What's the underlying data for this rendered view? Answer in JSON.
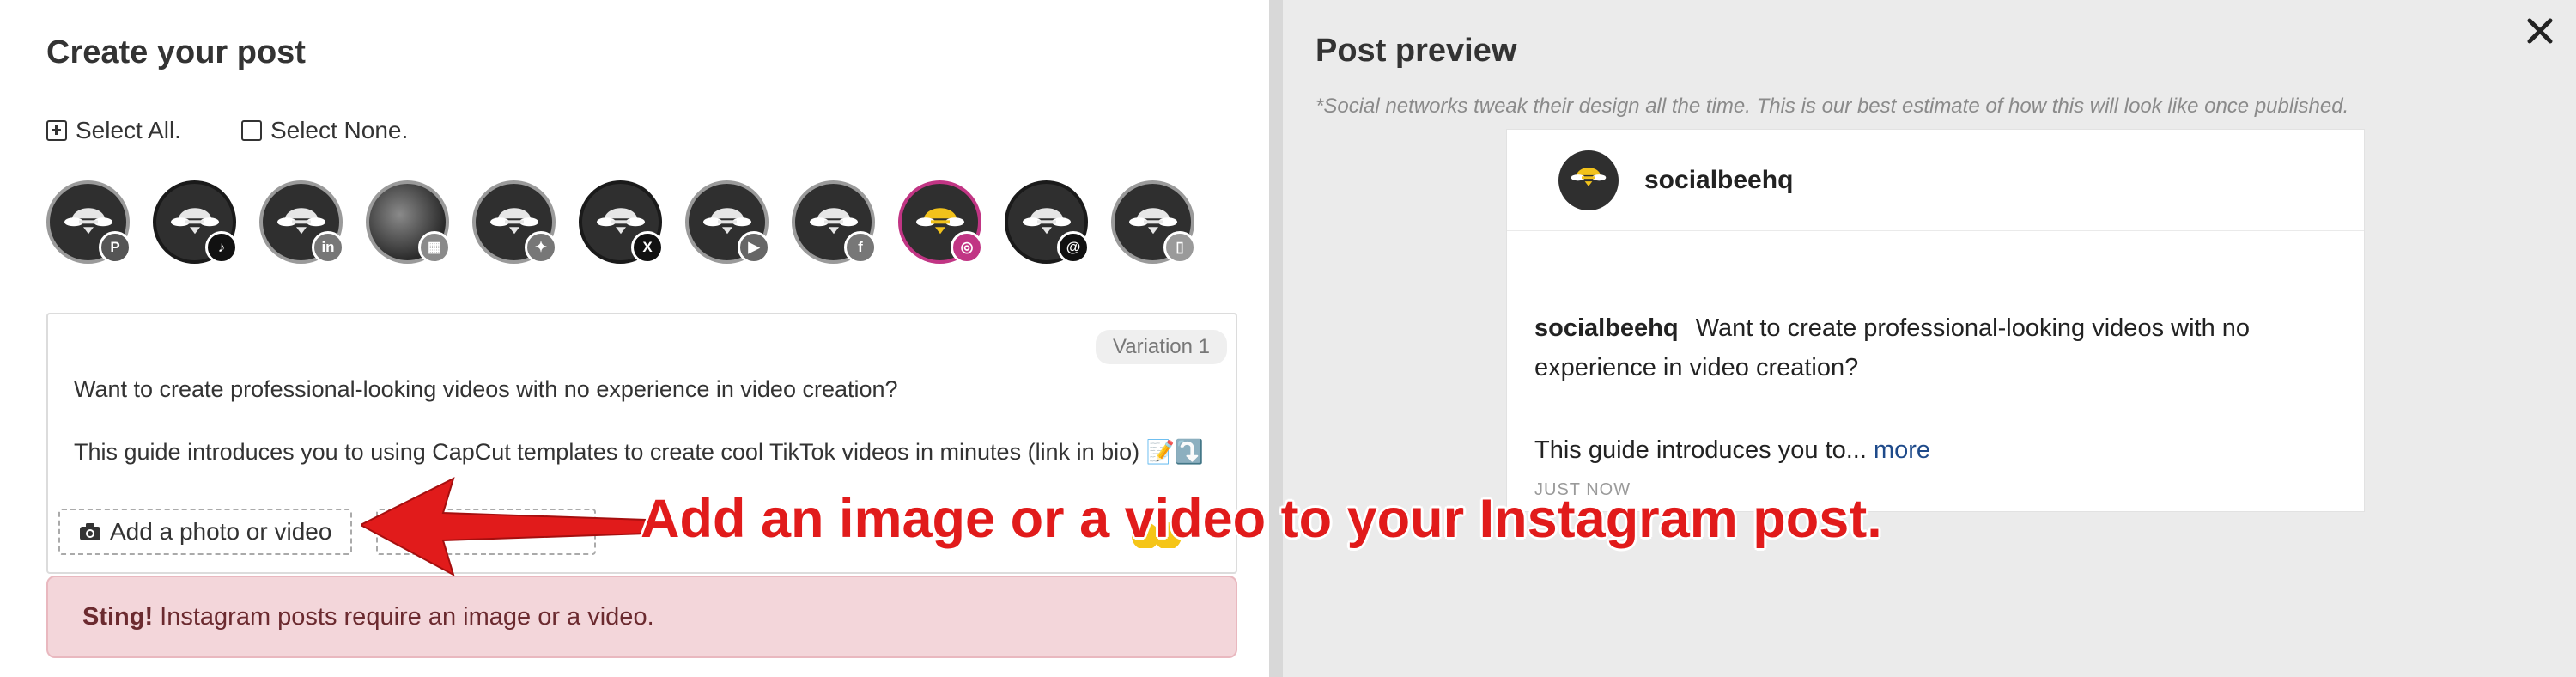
{
  "composer": {
    "title": "Create your post",
    "select_all": "Select All.",
    "select_none": "Select None.",
    "profiles": [
      {
        "network": "pinterest",
        "badge_color": "#555555",
        "badge_glyph": "P"
      },
      {
        "network": "tiktok",
        "badge_color": "#111111",
        "badge_glyph": "♪"
      },
      {
        "network": "linkedin",
        "badge_color": "#777777",
        "badge_glyph": "in"
      },
      {
        "network": "google-business",
        "badge_color": "#8a8a8a",
        "badge_glyph": "▦"
      },
      {
        "network": "bluesky",
        "badge_color": "#777777",
        "badge_glyph": "✦"
      },
      {
        "network": "x",
        "badge_color": "#111111",
        "badge_glyph": "X"
      },
      {
        "network": "youtube",
        "badge_color": "#666666",
        "badge_glyph": "▶"
      },
      {
        "network": "facebook",
        "badge_color": "#777777",
        "badge_glyph": "f"
      },
      {
        "network": "instagram",
        "badge_color": "#c13584",
        "badge_glyph": "◎"
      },
      {
        "network": "threads",
        "badge_color": "#111111",
        "badge_glyph": "@"
      },
      {
        "network": "mobile",
        "badge_color": "#9a9a9a",
        "badge_glyph": "▯"
      }
    ],
    "variation_label": "Variation 1",
    "post_line_1": "Want to create professional-looking videos with no experience in video creation?",
    "post_line_2": "This guide introduces you to using CapCut templates to create cool TikTok videos in minutes (link in bio) 📝⤵️",
    "add_media_label": "Add a photo or video",
    "alert_strong": "Sting!",
    "alert_text": "Instagram posts require an image or a video."
  },
  "preview": {
    "title": "Post preview",
    "note": "*Social networks tweak their design all the time. This is our best estimate of how this will look like once published.",
    "username": "socialbeehq",
    "caption_user": "socialbeehq",
    "caption_text": "Want to create professional-looking videos with no experience in video creation?",
    "caption_text_2": "This guide introduces you to...",
    "more_label": "more",
    "timestamp": "JUST NOW"
  },
  "annotation": {
    "text": "Add an image or a video to your Instagram post."
  },
  "colors": {
    "instagram": "#c13584",
    "alert_bg": "#f3d6da",
    "annotation_red": "#e11b1b",
    "link_blue": "#1e4a8a"
  }
}
